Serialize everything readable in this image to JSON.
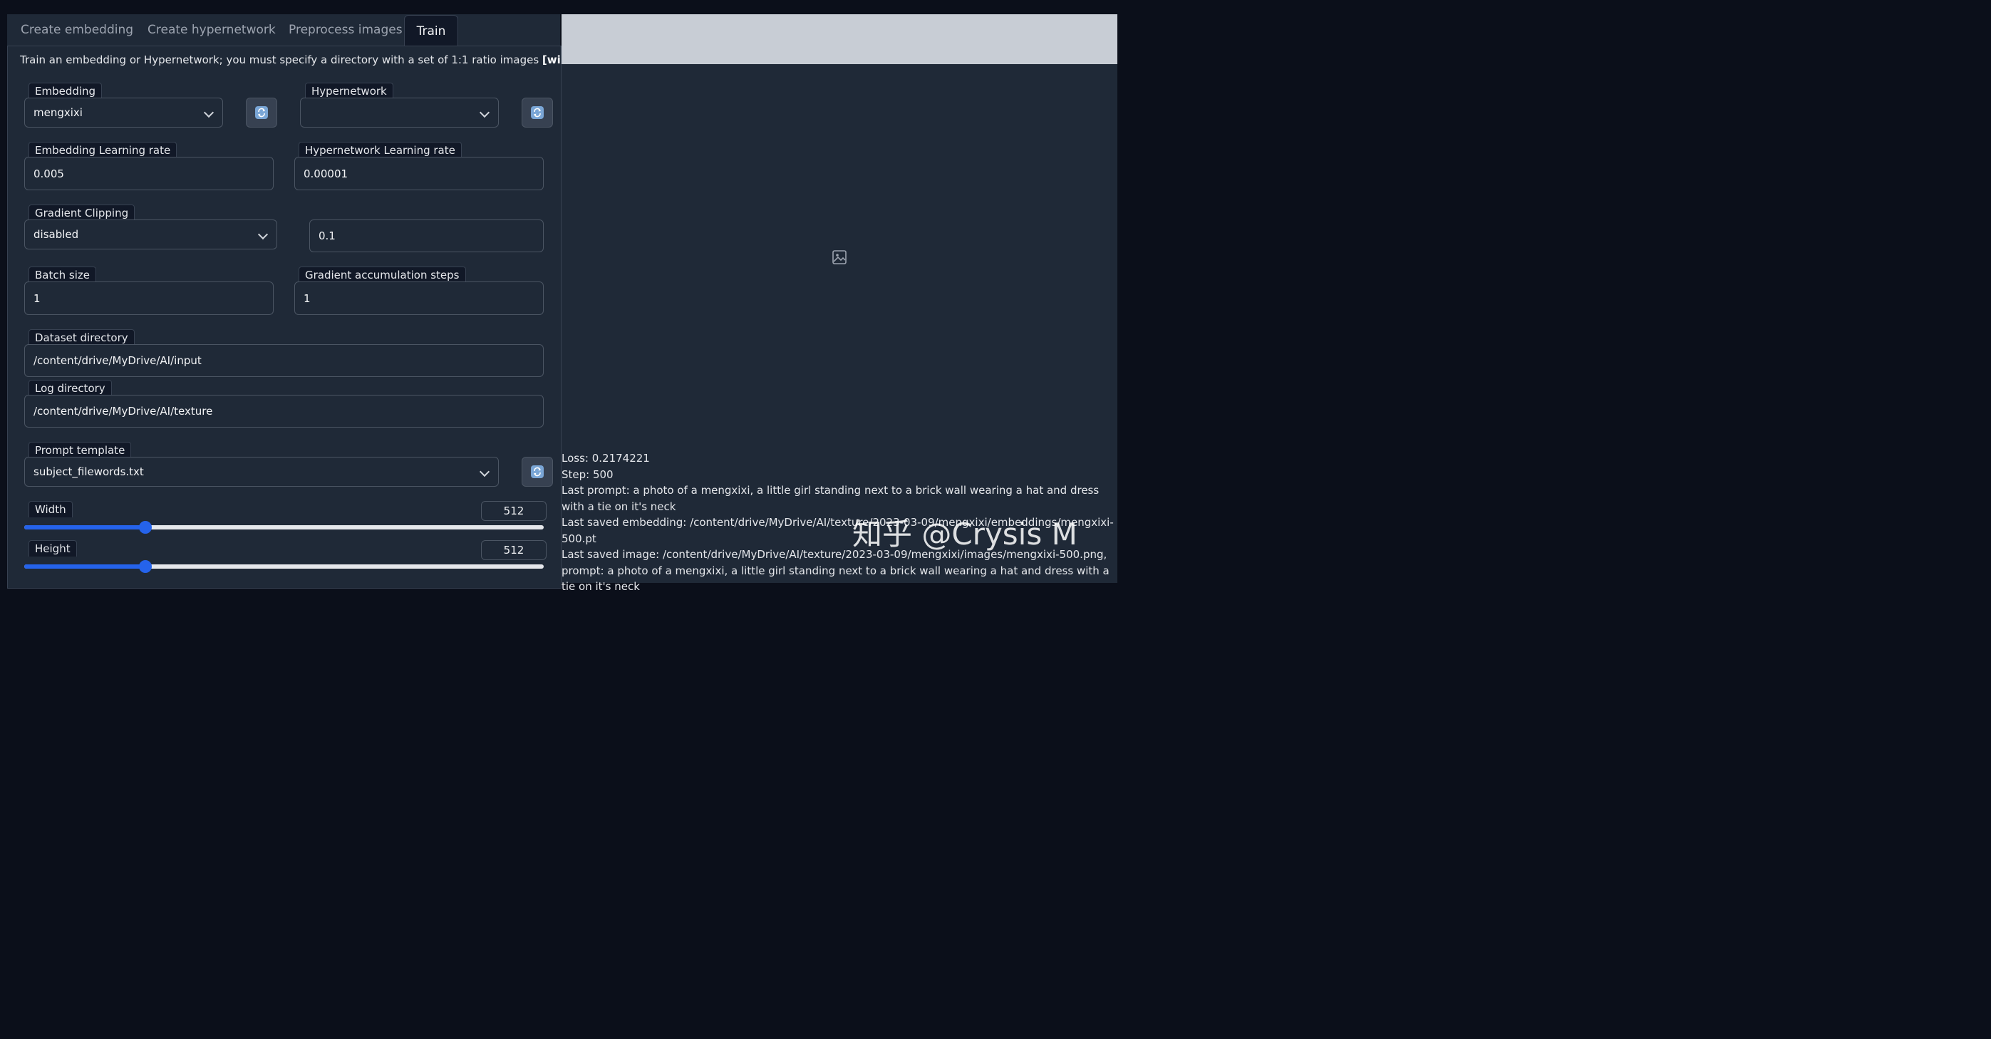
{
  "tabs": [
    {
      "label": "Create embedding",
      "active": false
    },
    {
      "label": "Create hypernetwork",
      "active": false
    },
    {
      "label": "Preprocess images",
      "active": false
    },
    {
      "label": "Train",
      "active": true
    }
  ],
  "description": {
    "text": "Train an embedding or Hypernetwork; you must specify a directory with a set of 1:1 ratio images",
    "link": "[wiki]"
  },
  "embedding": {
    "label": "Embedding",
    "value": "mengxixi"
  },
  "hypernetwork": {
    "label": "Hypernetwork",
    "value": ""
  },
  "embedding_lr": {
    "label": "Embedding Learning rate",
    "value": "0.005"
  },
  "hypernetwork_lr": {
    "label": "Hypernetwork Learning rate",
    "value": "0.00001"
  },
  "gradient_clipping": {
    "label": "Gradient Clipping",
    "value": "disabled",
    "threshold": "0.1"
  },
  "batch_size": {
    "label": "Batch size",
    "value": "1"
  },
  "grad_accum": {
    "label": "Gradient accumulation steps",
    "value": "1"
  },
  "dataset_dir": {
    "label": "Dataset directory",
    "value": "/content/drive/MyDrive/AI/input"
  },
  "log_dir": {
    "label": "Log directory",
    "value": "/content/drive/MyDrive/AI/texture"
  },
  "prompt_template": {
    "label": "Prompt template",
    "value": "subject_filewords.txt"
  },
  "width": {
    "label": "Width",
    "value": "512",
    "fraction": 0.233
  },
  "height": {
    "label": "Height",
    "value": "512",
    "fraction": 0.233
  },
  "status": {
    "loss": "Loss: 0.2174221",
    "step": "Step: 500",
    "last_prompt": "Last prompt: a photo of a mengxixi, a little girl standing next to a brick wall wearing a hat and dress with a tie on it's neck",
    "last_embedding": "Last saved embedding: /content/drive/MyDrive/AI/texture/2023-03-09/mengxixi/embeddings/mengxixi-500.pt",
    "last_image": "Last saved image: /content/drive/MyDrive/AI/texture/2023-03-09/mengxixi/images/mengxixi-500.png, prompt: a photo of a mengxixi, a little girl standing next to a brick wall wearing a hat and dress with a tie on it's neck"
  },
  "watermark": "知乎 @Crysis M",
  "colors": {
    "accent": "#2563eb",
    "panel": "#1f2937",
    "background": "#0b0f1a"
  }
}
